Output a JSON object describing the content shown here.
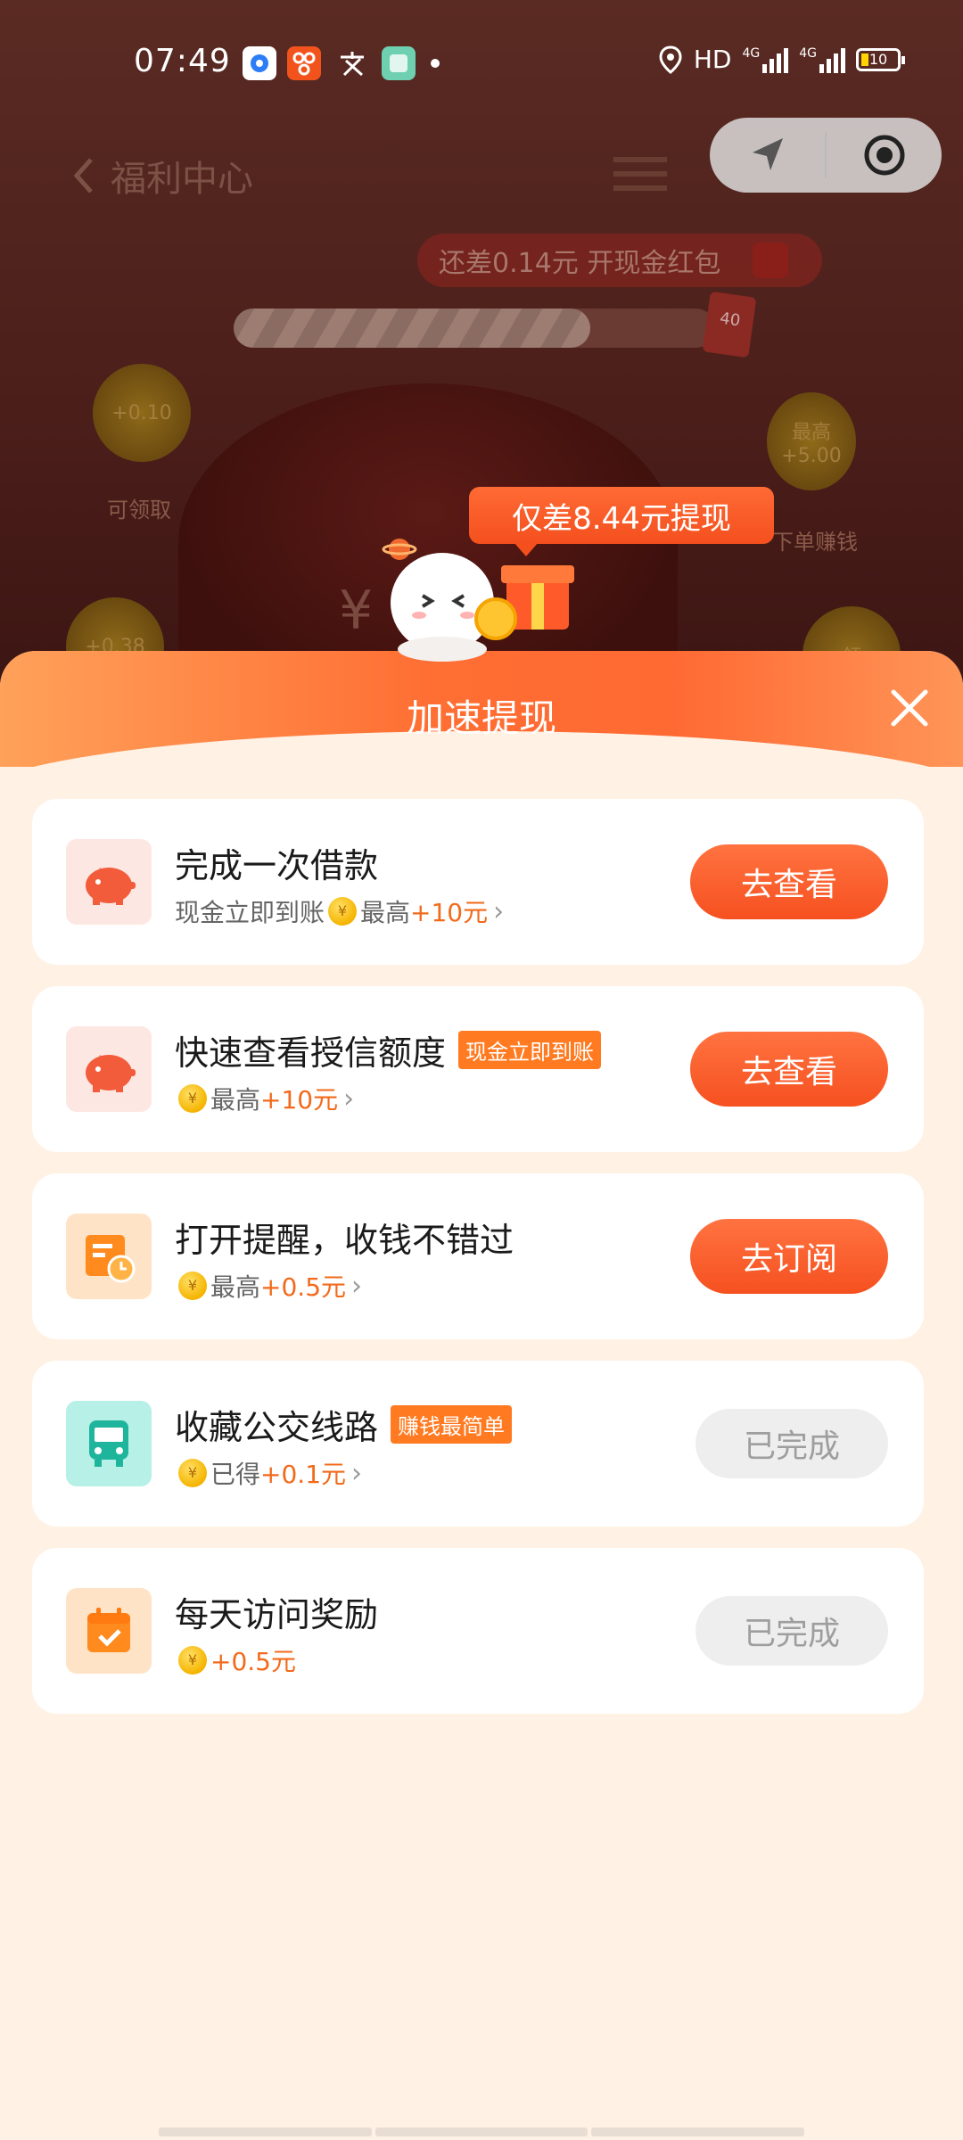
{
  "status_bar": {
    "time": "07:49",
    "network": "HD",
    "signal_1": "4G",
    "signal_2": "4G",
    "battery": "10"
  },
  "background": {
    "page_title": "福利中心",
    "progress_hint": "还差0.14元 开现金红包",
    "progress_flag": "40",
    "coin_left_top": "+0.10",
    "coin_left_top_label": "可领取",
    "coin_right_top": "最高 +5.00",
    "coin_right_label": "下单赚钱",
    "coin_left_bottom": "+0.38",
    "coin_right_bottom": "领",
    "bag_symbol": "¥"
  },
  "badge": {
    "text": "仅差8.44元提现"
  },
  "sheet": {
    "title": "加速提现",
    "tasks": [
      {
        "title": "完成一次借款",
        "tag": "",
        "prefix": "现金立即到账",
        "label": "最高",
        "amount": "+10元",
        "button": "去查看",
        "done": false
      },
      {
        "title": "快速查看授信额度",
        "tag": "现金立即到账",
        "prefix": "",
        "label": "最高",
        "amount": "+10元",
        "button": "去查看",
        "done": false
      },
      {
        "title": "打开提醒，收钱不错过",
        "tag": "",
        "prefix": "",
        "label": "最高",
        "amount": "+0.5元",
        "button": "去订阅",
        "done": false
      },
      {
        "title": "收藏公交线路",
        "tag": "赚钱最简单",
        "prefix": "",
        "label": "已得",
        "amount": "+0.1元",
        "button": "已完成",
        "done": true
      },
      {
        "title": "每天访问奖励",
        "tag": "",
        "prefix": "",
        "label": "",
        "amount": "+0.5元",
        "button": "已完成",
        "done": true
      }
    ]
  },
  "colors": {
    "accent": "#f65020",
    "amount": "#f26a1b",
    "sheet_bg": "#fff1e4"
  },
  "icons": {
    "task_1": "piggy-bank-icon",
    "task_2": "piggy-bank-icon",
    "task_3": "reminder-clock-icon",
    "task_4": "bus-icon",
    "task_5": "calendar-check-icon"
  }
}
